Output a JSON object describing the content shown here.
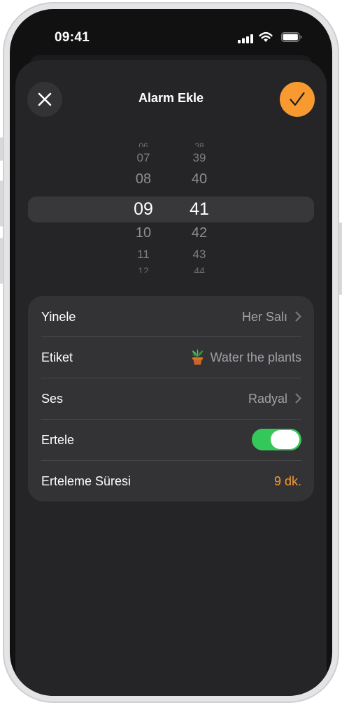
{
  "status_bar": {
    "time": "09:41"
  },
  "header": {
    "title": "Alarm Ekle"
  },
  "picker": {
    "hours": [
      "06",
      "07",
      "08",
      "09",
      "10",
      "11",
      "12"
    ],
    "minutes": [
      "38",
      "39",
      "40",
      "41",
      "42",
      "43",
      "44"
    ],
    "selected_hour": "09",
    "selected_minute": "41"
  },
  "settings": {
    "repeat": {
      "label": "Yinele",
      "value": "Her Salı"
    },
    "label": {
      "label": "Etiket",
      "value": "Water the plants",
      "icon": "potted-plant-icon"
    },
    "sound": {
      "label": "Ses",
      "value": "Radyal"
    },
    "snooze": {
      "label": "Ertele",
      "enabled": true
    },
    "snooze_duration": {
      "label": "Erteleme Süresi",
      "value": "9 dk."
    }
  },
  "colors": {
    "accent": "#f99a30",
    "toggle_on": "#34c759",
    "sheet": "#252527",
    "group": "#333336"
  }
}
